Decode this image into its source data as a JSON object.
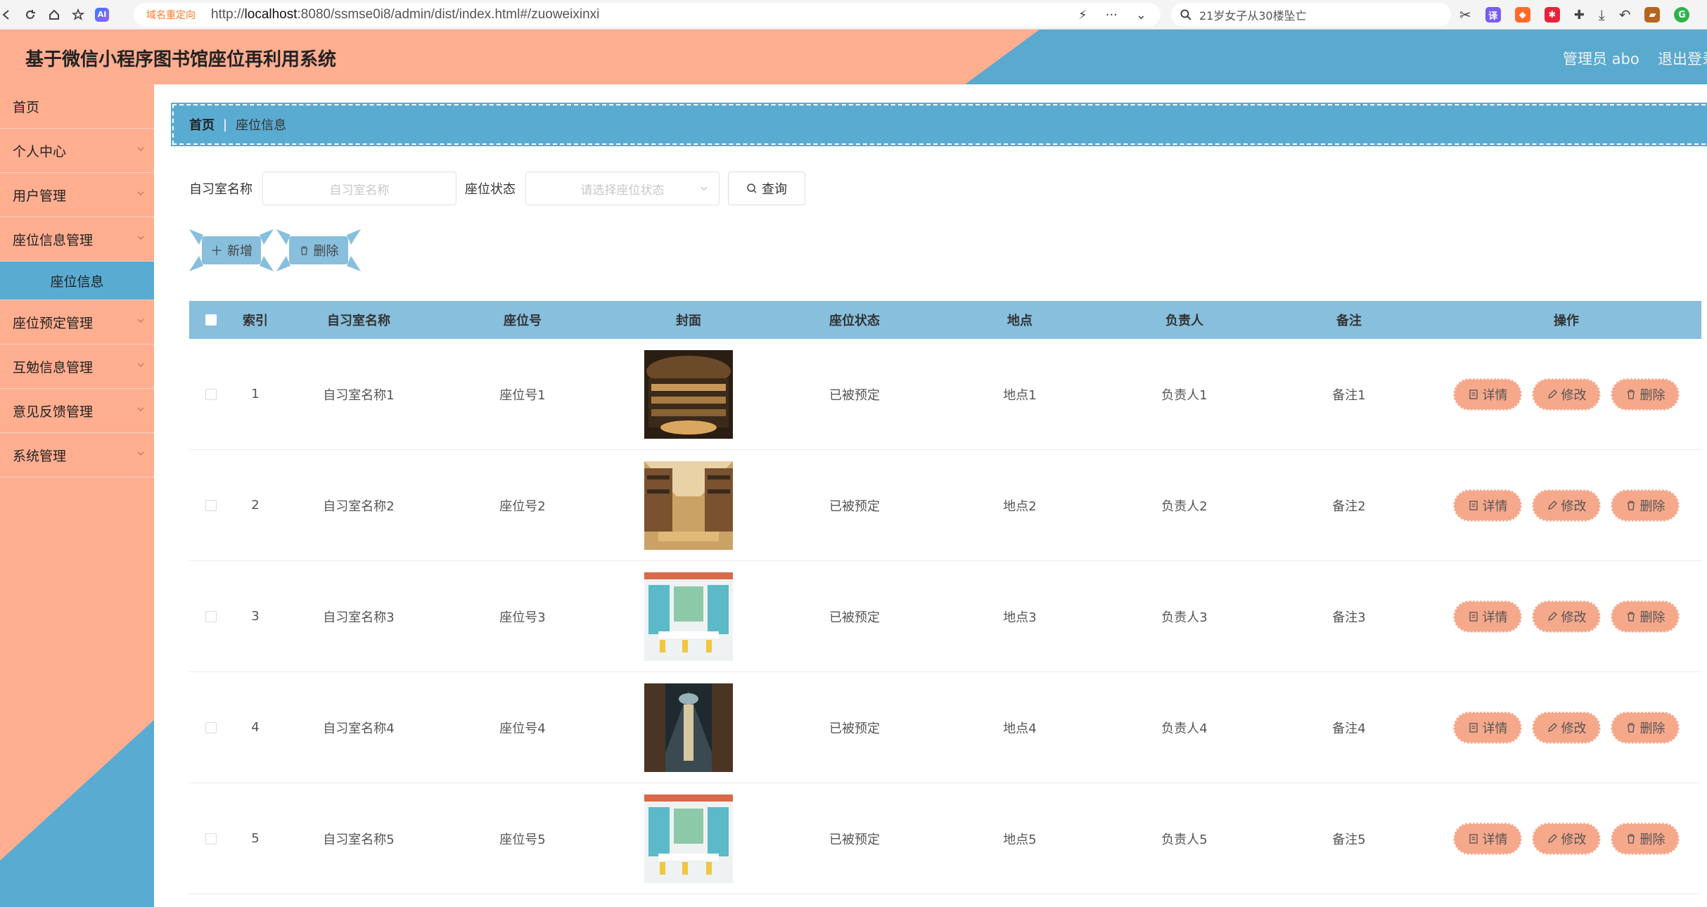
{
  "browser": {
    "redirect_tag": "域名重定向",
    "url_prefix": "http://",
    "url_host": "localhost",
    "url_rest": ":8080/ssmse0i8/admin/dist/index.html#/zuoweixinxi",
    "search_query": "21岁女子从30楼坠亡"
  },
  "header": {
    "title": "基于微信小程序图书馆座位再利用系统",
    "admin": "管理员 abo",
    "logout": "退出登录"
  },
  "sidebar": {
    "items": [
      {
        "label": "首页"
      },
      {
        "label": "个人中心"
      },
      {
        "label": "用户管理"
      },
      {
        "label": "座位信息管理"
      },
      {
        "label": "座位信息"
      },
      {
        "label": "座位预定管理"
      },
      {
        "label": "互勉信息管理"
      },
      {
        "label": "意见反馈管理"
      },
      {
        "label": "系统管理"
      }
    ]
  },
  "breadcrumb": {
    "home": "首页",
    "separator": "|",
    "current": "座位信息"
  },
  "filters": {
    "room_label": "自习室名称",
    "room_placeholder": "自习室名称",
    "status_label": "座位状态",
    "status_placeholder": "请选择座位状态",
    "query": "查询"
  },
  "actions": {
    "add": "新增",
    "delete": "删除"
  },
  "table": {
    "headers": [
      "索引",
      "自习室名称",
      "座位号",
      "封面",
      "座位状态",
      "地点",
      "负责人",
      "备注",
      "操作"
    ],
    "rows": [
      {
        "index": "1",
        "room": "自习室名称1",
        "seat": "座位号1",
        "status": "已被预定",
        "place": "地点1",
        "owner": "负责人1",
        "note": "备注1"
      },
      {
        "index": "2",
        "room": "自习室名称2",
        "seat": "座位号2",
        "status": "已被预定",
        "place": "地点2",
        "owner": "负责人2",
        "note": "备注2"
      },
      {
        "index": "3",
        "room": "自习室名称3",
        "seat": "座位号3",
        "status": "已被预定",
        "place": "地点3",
        "owner": "负责人3",
        "note": "备注3"
      },
      {
        "index": "4",
        "room": "自习室名称4",
        "seat": "座位号4",
        "status": "已被预定",
        "place": "地点4",
        "owner": "负责人4",
        "note": "备注4"
      },
      {
        "index": "5",
        "room": "自习室名称5",
        "seat": "座位号5",
        "status": "已被预定",
        "place": "地点5",
        "owner": "负责人5",
        "note": "备注5"
      }
    ],
    "row_ops": {
      "detail": "详情",
      "edit": "修改",
      "delete": "删除"
    }
  },
  "colors": {
    "salmon": "#ffae90",
    "blue": "#5aabd2",
    "header_blue": "#87bfdd",
    "op_button": "#f6a88b"
  }
}
